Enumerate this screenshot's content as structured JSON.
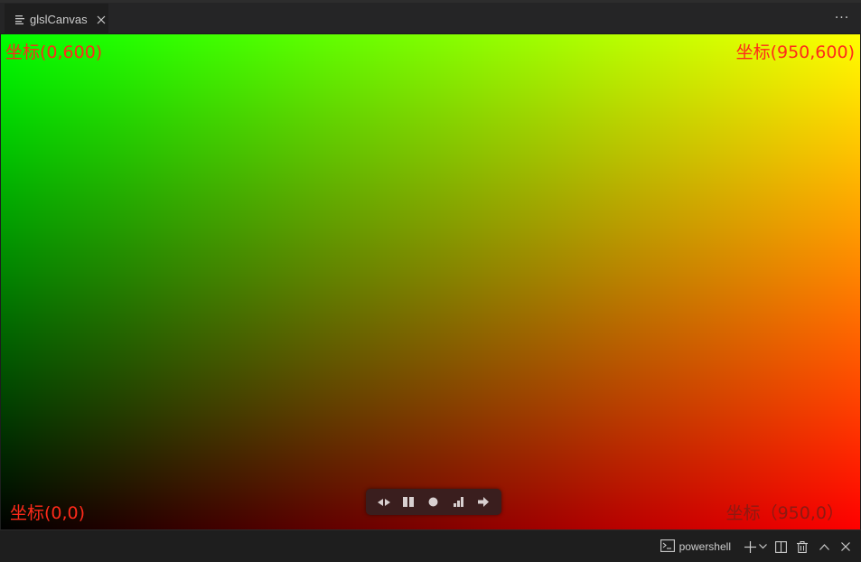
{
  "editor": {
    "tab": {
      "label": "glslCanvas",
      "icon": "file-lines-icon",
      "close_icon": "close-icon"
    },
    "more_actions_label": "···"
  },
  "canvas": {
    "labels": {
      "top_left": "坐标(0,600)",
      "top_right": "坐标(950,600)",
      "bottom_left": "坐标(0,0)",
      "bottom_right": "坐标（950,0）"
    },
    "colors": {
      "bottom_left": "#000000",
      "bottom_right": "#ff0000",
      "top_left": "#00ff00",
      "top_right": "#ffff00",
      "label": "#ff2a1a"
    },
    "controls": [
      {
        "name": "seek-icon"
      },
      {
        "name": "pause-icon"
      },
      {
        "name": "record-icon"
      },
      {
        "name": "stats-icon"
      },
      {
        "name": "arrow-right-icon"
      }
    ]
  },
  "panel": {
    "terminal_label": "powershell",
    "icons": [
      "terminal-icon",
      "plus-icon",
      "chevron-down-icon",
      "split-icon",
      "trash-icon",
      "chevron-up-icon",
      "close-icon"
    ]
  }
}
